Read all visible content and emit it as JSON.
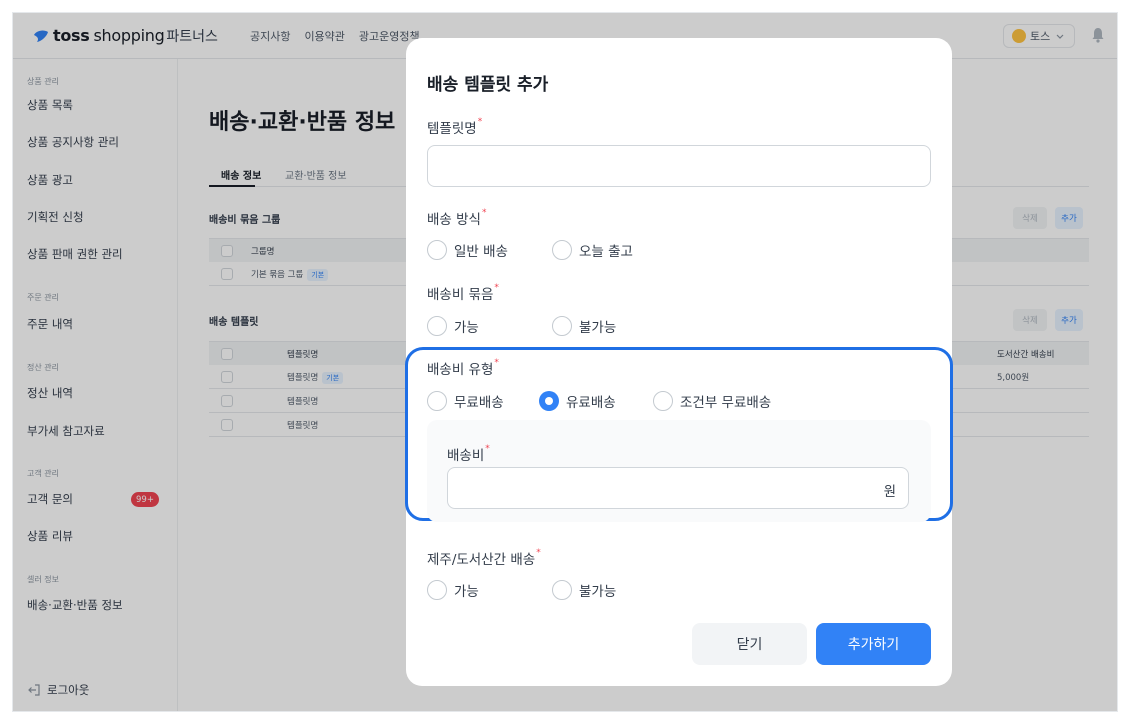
{
  "header": {
    "brand_toss": "toss",
    "brand_shopping": "shopping",
    "brand_partners": "파트너스",
    "nav": [
      "공지사항",
      "이용약관",
      "광고운영정책"
    ],
    "user_name": "토스"
  },
  "sidebar": {
    "sections": [
      {
        "title": "상품 관리",
        "items": [
          "상품 목록",
          "상품 공지사항 관리",
          "상품 광고",
          "기획전 신청",
          "상품 판매 권한 관리"
        ]
      },
      {
        "title": "주문 관리",
        "items": [
          "주문 내역"
        ]
      },
      {
        "title": "정산 관리",
        "items": [
          "정산 내역",
          "부가세 참고자료"
        ]
      },
      {
        "title": "고객 관리",
        "items": [
          "고객 문의",
          "상품 리뷰"
        ]
      },
      {
        "title": "셀러 정보",
        "items": [
          "배송·교환·반품 정보"
        ]
      }
    ],
    "inquiry_badge": "99+",
    "logout": "로그아웃"
  },
  "main": {
    "title": "배송·교환·반품 정보",
    "tabs": [
      "배송 정보",
      "교환·반품 정보"
    ],
    "group_section": {
      "title": "배송비 묶음 그룹",
      "delete_label": "삭제",
      "add_label": "추가",
      "header": "그룹명",
      "rows": [
        {
          "name": "기본 묶음 그룹",
          "tag": "기본"
        }
      ]
    },
    "template_section": {
      "title": "배송 템플릿",
      "delete_label": "삭제",
      "add_label": "추가",
      "header_name": "템플릿명",
      "header_fee": "도서산간 배송비",
      "rows": [
        {
          "name": "템플릿명",
          "tag": "기본",
          "fee": "5,000원"
        },
        {
          "name": "템플릿명",
          "tag": "",
          "fee": ""
        },
        {
          "name": "템플릿명",
          "tag": "",
          "fee": ""
        }
      ]
    }
  },
  "modal": {
    "title": "배송 템플릿 추가",
    "template_name_label": "템플릿명",
    "template_name_value": "",
    "shipping_method": {
      "label": "배송 방식",
      "options": [
        "일반 배송",
        "오늘 출고"
      ],
      "selected": null
    },
    "bundle": {
      "label": "배송비 묶음",
      "options": [
        "가능",
        "불가능"
      ],
      "selected": null
    },
    "fee_type": {
      "label": "배송비 유형",
      "options": [
        "무료배송",
        "유료배송",
        "조건부 무료배송"
      ],
      "selected": "유료배송"
    },
    "fee": {
      "label": "배송비",
      "value": "",
      "unit": "원"
    },
    "island_shipping": {
      "label": "제주/도서산간 배송",
      "options": [
        "가능",
        "불가능"
      ],
      "selected": null
    },
    "close_label": "닫기",
    "submit_label": "추가하기",
    "required_mark": "*"
  },
  "colors": {
    "accent": "#3182f6",
    "required": "#f04452",
    "highlight": "#1f6fe5"
  }
}
